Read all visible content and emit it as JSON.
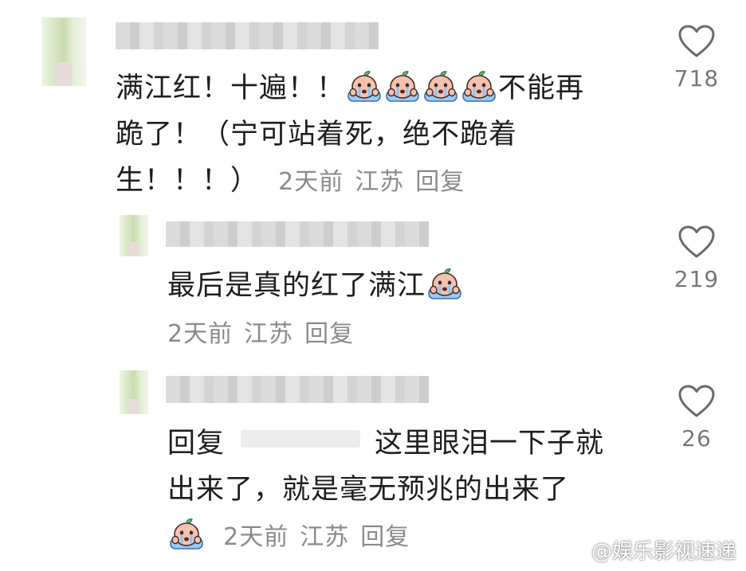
{
  "comments": [
    {
      "text_line1": "满江红！十遍！！",
      "text_line1b": "不能再",
      "text_line2": "跪了！（宁可站着死，绝不跪着",
      "text_line3": "生！！！）",
      "time": "2天前",
      "location": "江苏",
      "reply": "回复",
      "likes": "718"
    },
    {
      "text": "最后是真的红了满江",
      "time": "2天前",
      "location": "江苏",
      "reply": "回复",
      "likes": "219"
    },
    {
      "reply_prefix": "回复",
      "text_line1": "这里眼泪一下子就",
      "text_line2": "出来了，就是毫无预兆的出来了",
      "time": "2天前",
      "location": "江苏",
      "reply": "回复",
      "likes": "26"
    }
  ],
  "watermark": "@娱乐影视速递",
  "icons": {
    "like": "heart-outline-icon",
    "emoji": "crying-face-emoji"
  },
  "colors": {
    "text": "#1e1e1e",
    "meta": "#8a8a8a",
    "emoji_body": "#f5b9a8",
    "emoji_leaf": "#6cc07a",
    "emoji_tears": "#8fc3f0"
  }
}
